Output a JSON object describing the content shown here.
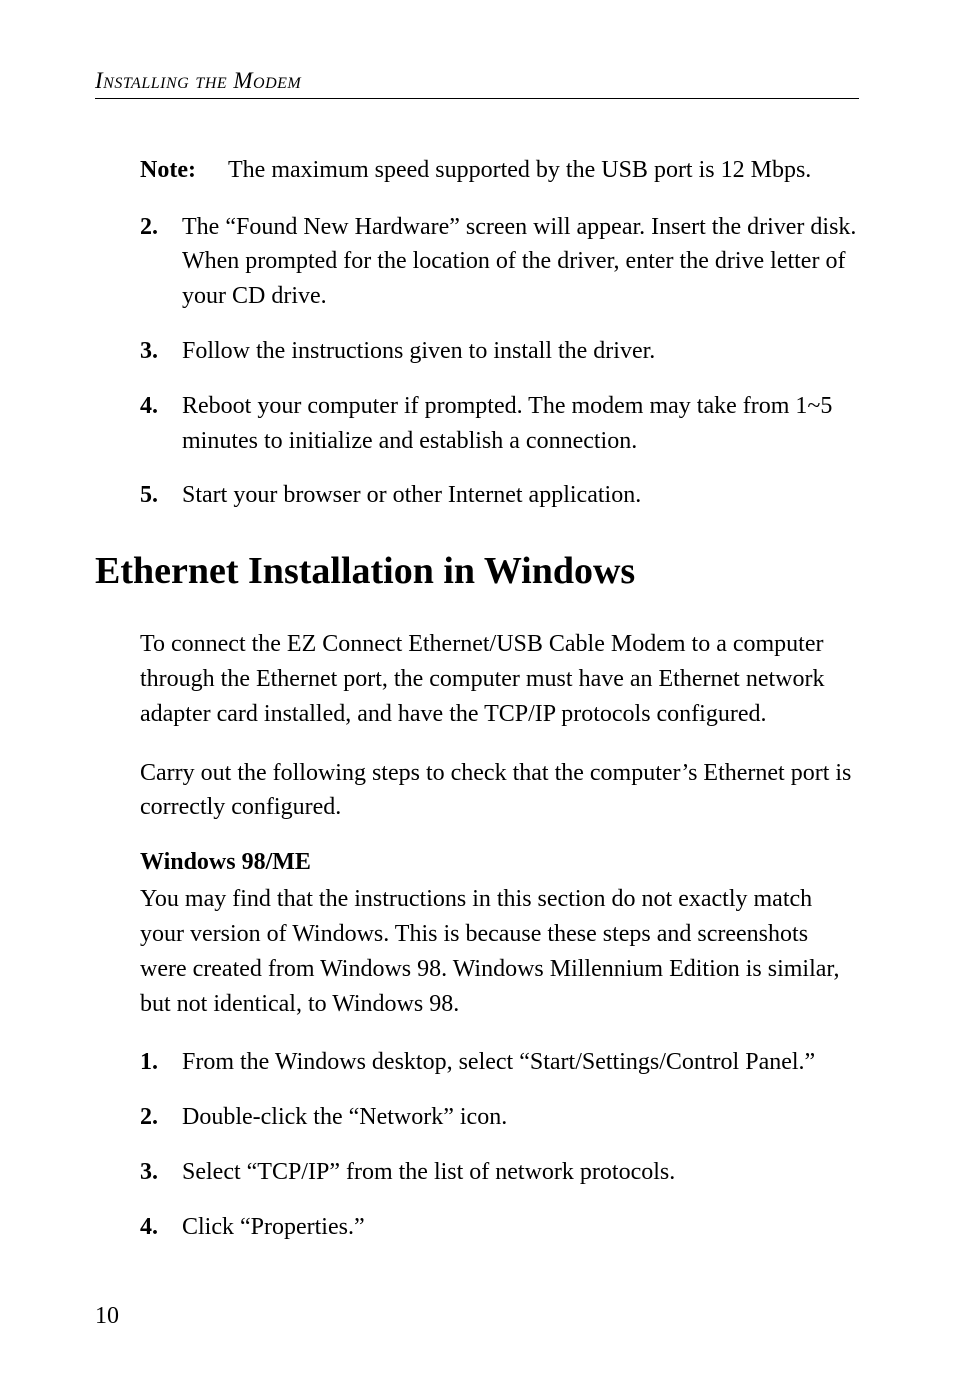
{
  "header": {
    "running_title": "Installing the Modem"
  },
  "note": {
    "label": "Note:",
    "text": "The maximum speed supported by the USB port is 12 Mbps."
  },
  "first_list": [
    {
      "num": "2.",
      "text": "The “Found New Hardware” screen will appear. Insert the driver disk. When prompted for the location of the driver, enter the drive letter of your CD drive."
    },
    {
      "num": "3.",
      "text": "Follow the instructions given to install the driver."
    },
    {
      "num": "4.",
      "text": "Reboot your computer if prompted.  The modem may take from 1~5 minutes to initialize and establish a connection."
    },
    {
      "num": "5.",
      "text": "Start your browser or other Internet application."
    }
  ],
  "section_title": "Ethernet Installation in Windows",
  "para1": "To connect the EZ Connect Ethernet/USB Cable Modem to a computer through the Ethernet port, the computer must have an Ethernet network adapter card installed, and have the TCP/IP protocols configured.",
  "para2": "Carry out the following steps to check that the computer’s Ethernet port is correctly configured.",
  "subhead": "Windows 98/ME",
  "para3": "You may find that the instructions in this section do not exactly match your version of Windows. This is because these steps and screenshots were created from Windows 98. Windows Millennium Edition is similar, but not identical, to Windows 98.",
  "second_list": [
    {
      "num": "1.",
      "text": "From the Windows desktop, select “Start/Settings/Control Panel.”"
    },
    {
      "num": "2.",
      "text": "Double-click the “Network” icon."
    },
    {
      "num": "3.",
      "text": "Select “TCP/IP” from the list of network protocols."
    },
    {
      "num": "4.",
      "text": "Click “Properties.”"
    }
  ],
  "page_number": "10"
}
